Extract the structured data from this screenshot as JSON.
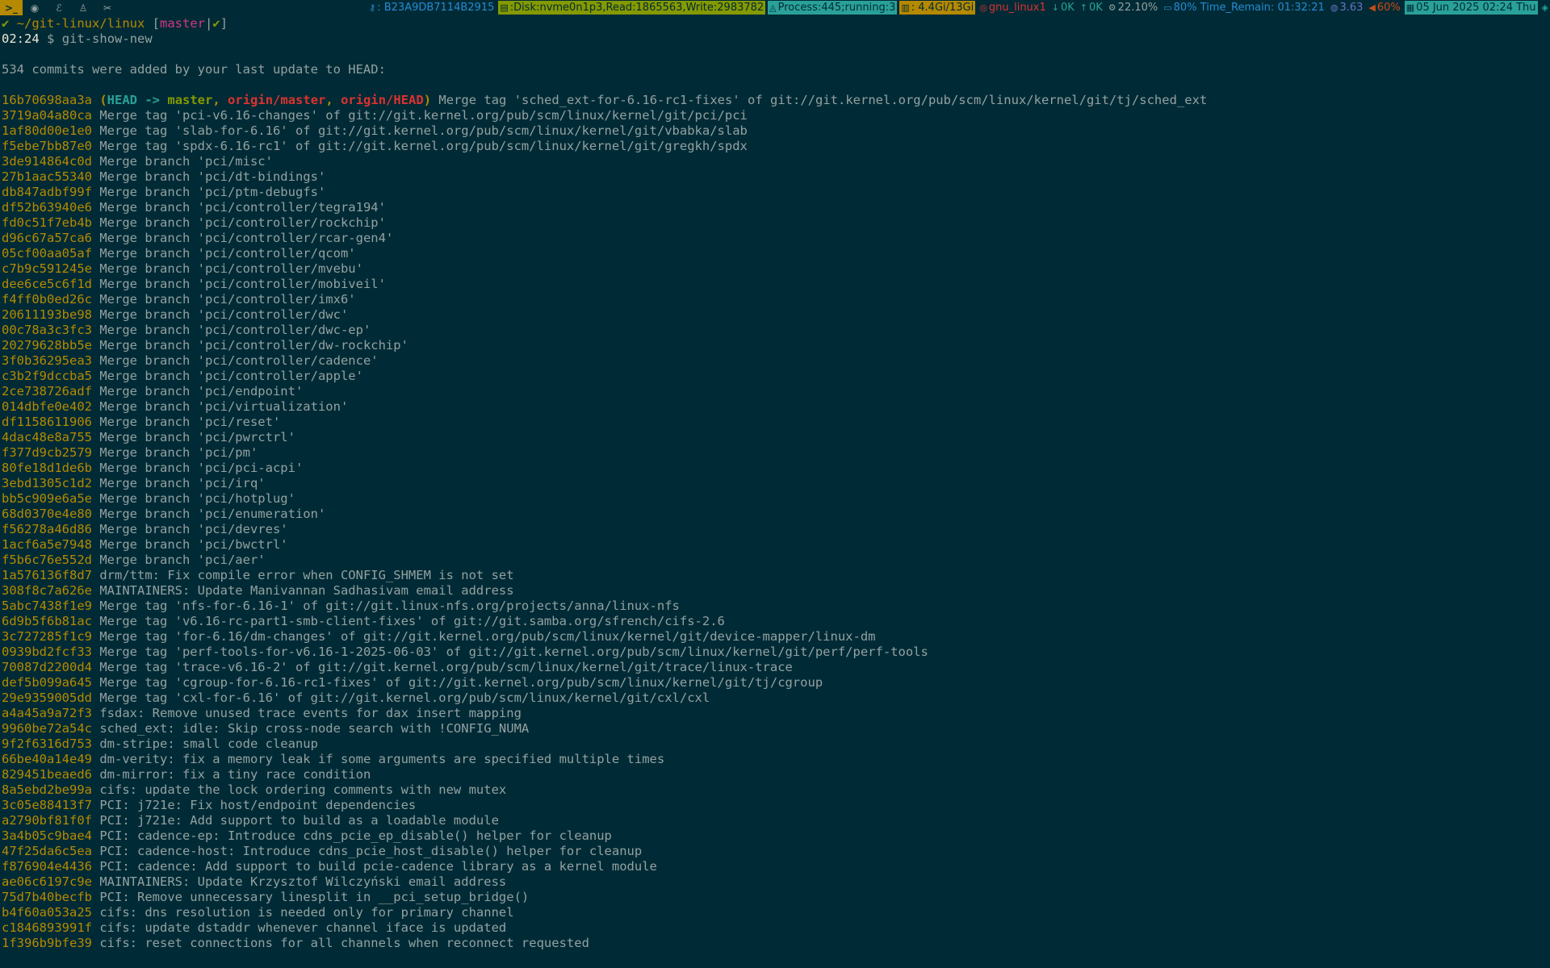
{
  "topbar": {
    "workspaces": [
      {
        "icon": "terminal-icon",
        "glyph": ">_",
        "active": true
      },
      {
        "icon": "browser-icon",
        "glyph": "◉",
        "active": false
      },
      {
        "icon": "editor-icon",
        "glyph": "ℰ",
        "active": false
      },
      {
        "icon": "linux-icon",
        "glyph": "♙",
        "active": false
      },
      {
        "icon": "tools-icon",
        "glyph": "✂",
        "active": false
      }
    ],
    "status": [
      {
        "name": "key",
        "icon": "key-icon",
        "glyph": "⚷",
        "text": ": B23A9DB7114B2915",
        "bg": "",
        "fg": "#268bd2"
      },
      {
        "name": "disk",
        "icon": "disk-icon",
        "glyph": "▤",
        "text": ":Disk:nvme0n1p3,Read:1865563,Write:2983782",
        "bg": "#859900",
        "fg": "#002b36"
      },
      {
        "name": "process",
        "icon": "process-icon",
        "glyph": "◬",
        "text": " Process:445;running:3",
        "bg": "#2aa198",
        "fg": "#002b36"
      },
      {
        "name": "memory",
        "icon": "memory-icon",
        "glyph": "▥",
        "text": " : 4.4Gi/13Gi",
        "bg": "#b58900",
        "fg": "#002b36"
      },
      {
        "name": "wifi",
        "icon": "wifi-icon",
        "glyph": "◎",
        "text": " gnu_linux1",
        "bg": "",
        "fg": "#dc322f"
      },
      {
        "name": "net-down",
        "icon": "arrow-down-icon",
        "glyph": "↓",
        "text": "0K",
        "bg": "",
        "fg": "#2aa198"
      },
      {
        "name": "net-up",
        "icon": "arrow-up-icon",
        "glyph": "↑",
        "text": "0K",
        "bg": "",
        "fg": "#2aa198"
      },
      {
        "name": "cpu",
        "icon": "gear-icon",
        "glyph": "⚙",
        "text": " 22.10%",
        "bg": "",
        "fg": "#93a1a1"
      },
      {
        "name": "battery",
        "icon": "battery-icon",
        "glyph": "▭",
        "text": " 80% Time_Remain: 01:32:21",
        "bg": "",
        "fg": "#268bd2"
      },
      {
        "name": "load",
        "icon": "brain-icon",
        "glyph": "◍",
        "text": " 3.63",
        "bg": "",
        "fg": "#6c71c4"
      },
      {
        "name": "volume",
        "icon": "speaker-icon",
        "glyph": "◀",
        "text": " 60%",
        "bg": "",
        "fg": "#cb4b16"
      },
      {
        "name": "datetime",
        "icon": "calendar-icon",
        "glyph": "▦",
        "text": "05 Jun 2025 02:24 Thu",
        "bg": "#2aa198",
        "fg": "#002b36"
      },
      {
        "name": "tray",
        "icon": "tray-icon",
        "glyph": "◈",
        "text": "",
        "bg": "",
        "fg": "#2aa198"
      }
    ]
  },
  "prompt": {
    "check": "✔",
    "path": "~/git-linux/linux",
    "branch_open": "[",
    "branch": "master",
    "branch_sep": "|",
    "branch_ok": "✔",
    "branch_close": "]",
    "time": "02:24",
    "symbol": "$",
    "command": "git-show-new"
  },
  "summary": "534 commits were added by your last update to HEAD:",
  "head_commit": {
    "hash": "16b70698aa3a",
    "open": "(",
    "head": "HEAD",
    "arrow": "->",
    "branch": "master",
    "sep1": ",",
    "ref1": "origin/master",
    "sep2": ",",
    "ref2": "origin/HEAD",
    "close": ")",
    "message": "Merge tag 'sched_ext-for-6.16-rc1-fixes' of git://git.kernel.org/pub/scm/linux/kernel/git/tj/sched_ext"
  },
  "commits": [
    {
      "hash": "3719a04a80ca",
      "message": "Merge tag 'pci-v6.16-changes' of git://git.kernel.org/pub/scm/linux/kernel/git/pci/pci"
    },
    {
      "hash": "1af80d00e1e0",
      "message": "Merge tag 'slab-for-6.16' of git://git.kernel.org/pub/scm/linux/kernel/git/vbabka/slab"
    },
    {
      "hash": "f5ebe7bb87e0",
      "message": "Merge tag 'spdx-6.16-rc1' of git://git.kernel.org/pub/scm/linux/kernel/git/gregkh/spdx"
    },
    {
      "hash": "3de914864c0d",
      "message": "Merge branch 'pci/misc'"
    },
    {
      "hash": "27b1aac55340",
      "message": "Merge branch 'pci/dt-bindings'"
    },
    {
      "hash": "db847adbf99f",
      "message": "Merge branch 'pci/ptm-debugfs'"
    },
    {
      "hash": "df52b63940e6",
      "message": "Merge branch 'pci/controller/tegra194'"
    },
    {
      "hash": "fd0c51f7eb4b",
      "message": "Merge branch 'pci/controller/rockchip'"
    },
    {
      "hash": "d96c67a57ca6",
      "message": "Merge branch 'pci/controller/rcar-gen4'"
    },
    {
      "hash": "05cf00aa05af",
      "message": "Merge branch 'pci/controller/qcom'"
    },
    {
      "hash": "c7b9c591245e",
      "message": "Merge branch 'pci/controller/mvebu'"
    },
    {
      "hash": "dee6ce5c6f1d",
      "message": "Merge branch 'pci/controller/mobiveil'"
    },
    {
      "hash": "f4ff0b0ed26c",
      "message": "Merge branch 'pci/controller/imx6'"
    },
    {
      "hash": "20611193be98",
      "message": "Merge branch 'pci/controller/dwc'"
    },
    {
      "hash": "00c78a3c3fc3",
      "message": "Merge branch 'pci/controller/dwc-ep'"
    },
    {
      "hash": "20279628bb5e",
      "message": "Merge branch 'pci/controller/dw-rockchip'"
    },
    {
      "hash": "3f0b36295ea3",
      "message": "Merge branch 'pci/controller/cadence'"
    },
    {
      "hash": "c3b2f9dccba5",
      "message": "Merge branch 'pci/controller/apple'"
    },
    {
      "hash": "2ce738726adf",
      "message": "Merge branch 'pci/endpoint'"
    },
    {
      "hash": "014dbfe0e402",
      "message": "Merge branch 'pci/virtualization'"
    },
    {
      "hash": "df1158611906",
      "message": "Merge branch 'pci/reset'"
    },
    {
      "hash": "4dac48e8a755",
      "message": "Merge branch 'pci/pwrctrl'"
    },
    {
      "hash": "f377d9cb2579",
      "message": "Merge branch 'pci/pm'"
    },
    {
      "hash": "80fe18d1de6b",
      "message": "Merge branch 'pci/pci-acpi'"
    },
    {
      "hash": "3ebd1305c1d2",
      "message": "Merge branch 'pci/irq'"
    },
    {
      "hash": "bb5c909e6a5e",
      "message": "Merge branch 'pci/hotplug'"
    },
    {
      "hash": "68d0370e4e80",
      "message": "Merge branch 'pci/enumeration'"
    },
    {
      "hash": "f56278a46d86",
      "message": "Merge branch 'pci/devres'"
    },
    {
      "hash": "1acf6a5e7948",
      "message": "Merge branch 'pci/bwctrl'"
    },
    {
      "hash": "f5b6c76e552d",
      "message": "Merge branch 'pci/aer'"
    },
    {
      "hash": "1a576136f8d7",
      "message": "drm/ttm: Fix compile error when CONFIG_SHMEM is not set"
    },
    {
      "hash": "308f8c7a626e",
      "message": "MAINTAINERS: Update Manivannan Sadhasivam email address"
    },
    {
      "hash": "5abc7438f1e9",
      "message": "Merge tag 'nfs-for-6.16-1' of git://git.linux-nfs.org/projects/anna/linux-nfs"
    },
    {
      "hash": "6d9b5f6b81ac",
      "message": "Merge tag 'v6.16-rc-part1-smb-client-fixes' of git://git.samba.org/sfrench/cifs-2.6"
    },
    {
      "hash": "3c727285f1c9",
      "message": "Merge tag 'for-6.16/dm-changes' of git://git.kernel.org/pub/scm/linux/kernel/git/device-mapper/linux-dm"
    },
    {
      "hash": "0939bd2fcf33",
      "message": "Merge tag 'perf-tools-for-v6.16-1-2025-06-03' of git://git.kernel.org/pub/scm/linux/kernel/git/perf/perf-tools"
    },
    {
      "hash": "70087d2200d4",
      "message": "Merge tag 'trace-v6.16-2' of git://git.kernel.org/pub/scm/linux/kernel/git/trace/linux-trace"
    },
    {
      "hash": "def5b099a645",
      "message": "Merge tag 'cgroup-for-6.16-rc1-fixes' of git://git.kernel.org/pub/scm/linux/kernel/git/tj/cgroup"
    },
    {
      "hash": "29e9359005dd",
      "message": "Merge tag 'cxl-for-6.16' of git://git.kernel.org/pub/scm/linux/kernel/git/cxl/cxl"
    },
    {
      "hash": "a4a45a9a72f3",
      "message": "fsdax: Remove unused trace events for dax insert mapping"
    },
    {
      "hash": "9960be72a54c",
      "message": "sched_ext: idle: Skip cross-node search with !CONFIG_NUMA"
    },
    {
      "hash": "9f2f6316d753",
      "message": "dm-stripe: small code cleanup"
    },
    {
      "hash": "66be40a14e49",
      "message": "dm-verity: fix a memory leak if some arguments are specified multiple times"
    },
    {
      "hash": "829451beaed6",
      "message": "dm-mirror: fix a tiny race condition"
    },
    {
      "hash": "8a5ebd2be99a",
      "message": "cifs: update the lock ordering comments with new mutex"
    },
    {
      "hash": "3c05e88413f7",
      "message": "PCI: j721e: Fix host/endpoint dependencies"
    },
    {
      "hash": "a2790bf81f0f",
      "message": "PCI: j721e: Add support to build as a loadable module"
    },
    {
      "hash": "3a4b05c9bae4",
      "message": "PCI: cadence-ep: Introduce cdns_pcie_ep_disable() helper for cleanup"
    },
    {
      "hash": "47f25da6c5ea",
      "message": "PCI: cadence-host: Introduce cdns_pcie_host_disable() helper for cleanup"
    },
    {
      "hash": "f876904e4436",
      "message": "PCI: cadence: Add support to build pcie-cadence library as a kernel module"
    },
    {
      "hash": "ae06c6197c9e",
      "message": "MAINTAINERS: Update Krzysztof Wilczyński email address"
    },
    {
      "hash": "75d7b40becfb",
      "message": "PCI: Remove unnecessary linesplit in __pci_setup_bridge()"
    },
    {
      "hash": "b4f60a053a25",
      "message": "cifs: dns resolution is needed only for primary channel"
    },
    {
      "hash": "c1846893991f",
      "message": "cifs: update dstaddr whenever channel iface is updated"
    },
    {
      "hash": "1f396b9bfe39",
      "message": "cifs: reset connections for all channels when reconnect requested"
    }
  ]
}
